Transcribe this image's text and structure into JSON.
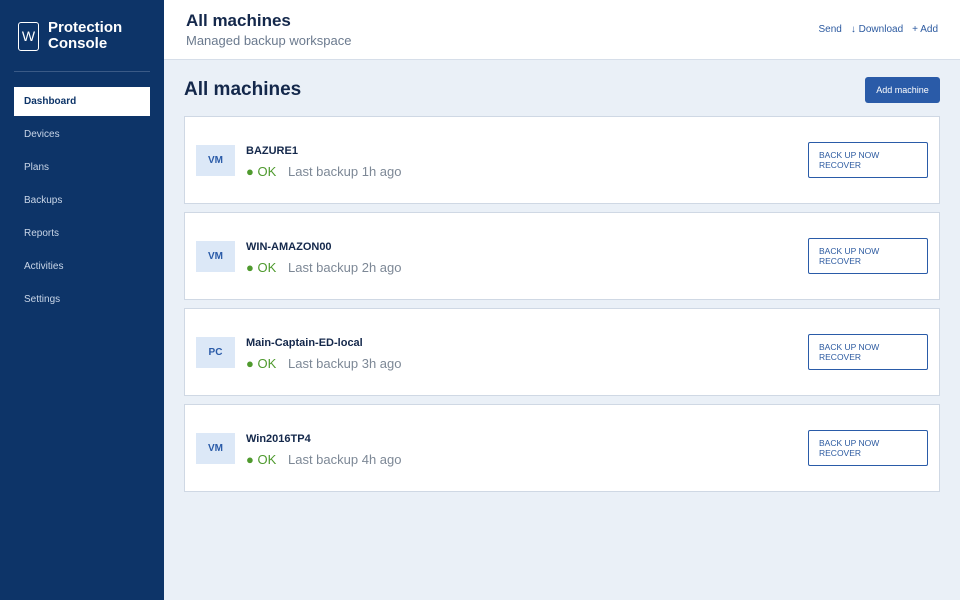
{
  "sidebar": {
    "brand_letter": "W",
    "brand_name": "Protection Console",
    "items": [
      {
        "label": "Dashboard",
        "active": true
      },
      {
        "label": "Devices"
      },
      {
        "label": "Plans"
      },
      {
        "label": "Backups"
      },
      {
        "label": "Reports"
      },
      {
        "label": "Activities"
      },
      {
        "label": "Settings"
      }
    ]
  },
  "header": {
    "title": "All machines",
    "subtitle": "Managed backup workspace",
    "actions": {
      "send": "Send",
      "download": "↓ Download",
      "add": "+ Add"
    }
  },
  "main": {
    "title": "All machines",
    "add_button": "Add machine",
    "machines": [
      {
        "type": "VM",
        "name": "BAZURE1",
        "status": "● OK",
        "last_backup": "Last backup 1h ago",
        "backup_label": "BACK UP NOW",
        "recover_label": "RECOVER"
      },
      {
        "type": "VM",
        "name": "WIN-AMAZON00",
        "status": "● OK",
        "last_backup": "Last backup 2h ago",
        "backup_label": "BACK UP NOW",
        "recover_label": "RECOVER"
      },
      {
        "type": "PC",
        "name": "Main-Captain-ED-local",
        "status": "● OK",
        "last_backup": "Last backup 3h ago",
        "backup_label": "BACK UP NOW",
        "recover_label": "RECOVER"
      },
      {
        "type": "VM",
        "name": "Win2016TP4",
        "status": "● OK",
        "last_backup": "Last backup 4h ago",
        "backup_label": "BACK UP NOW",
        "recover_label": "RECOVER"
      }
    ]
  },
  "colors": {
    "sidebar_bg": "#0d3468",
    "accent": "#2a5ba8",
    "ok": "#4f9a2e"
  }
}
